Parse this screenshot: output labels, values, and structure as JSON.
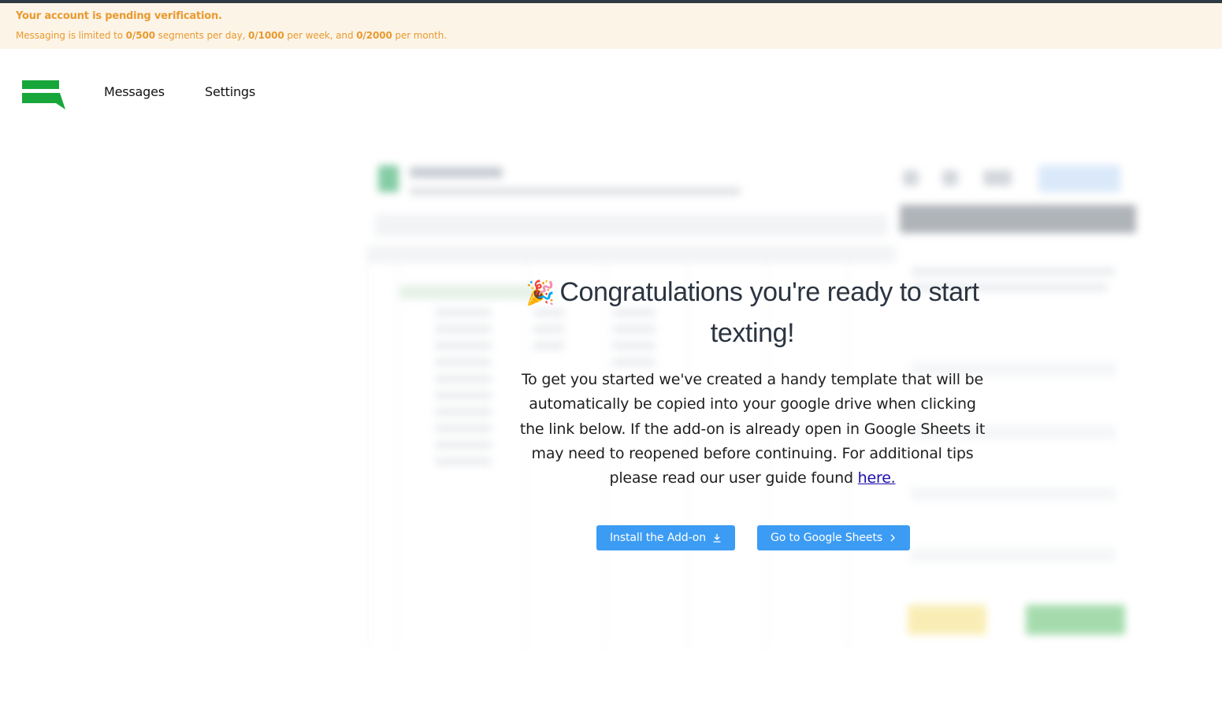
{
  "banner": {
    "title": "Your account is pending verification.",
    "prefix": "Messaging is limited to ",
    "day_limit": "0/500",
    "day_text": " segments per day, ",
    "week_limit": "0/1000",
    "week_text": " per week, and ",
    "month_limit": "0/2000",
    "month_text": " per month."
  },
  "nav": {
    "messages": "Messages",
    "settings": "Settings"
  },
  "main": {
    "emoji": "🎉",
    "title": "Congratulations you're ready to start texting!",
    "description": "To get you started we've created a handy template that will be automatically be copied into your google drive when clicking the link below. If the add-on is already open in Google Sheets it may need to reopened before continuing. For additional tips please read our user guide found ",
    "link_text": "here."
  },
  "buttons": {
    "install": "Install the Add-on",
    "sheets": "Go to Google Sheets"
  },
  "colors": {
    "brand_green": "#17a63a",
    "banner_bg": "#fdf4e8",
    "banner_text": "#e89a2e",
    "button_blue": "#3c9cf4"
  },
  "icons": {
    "install": "download-icon",
    "sheets": "chevron-right-icon"
  }
}
